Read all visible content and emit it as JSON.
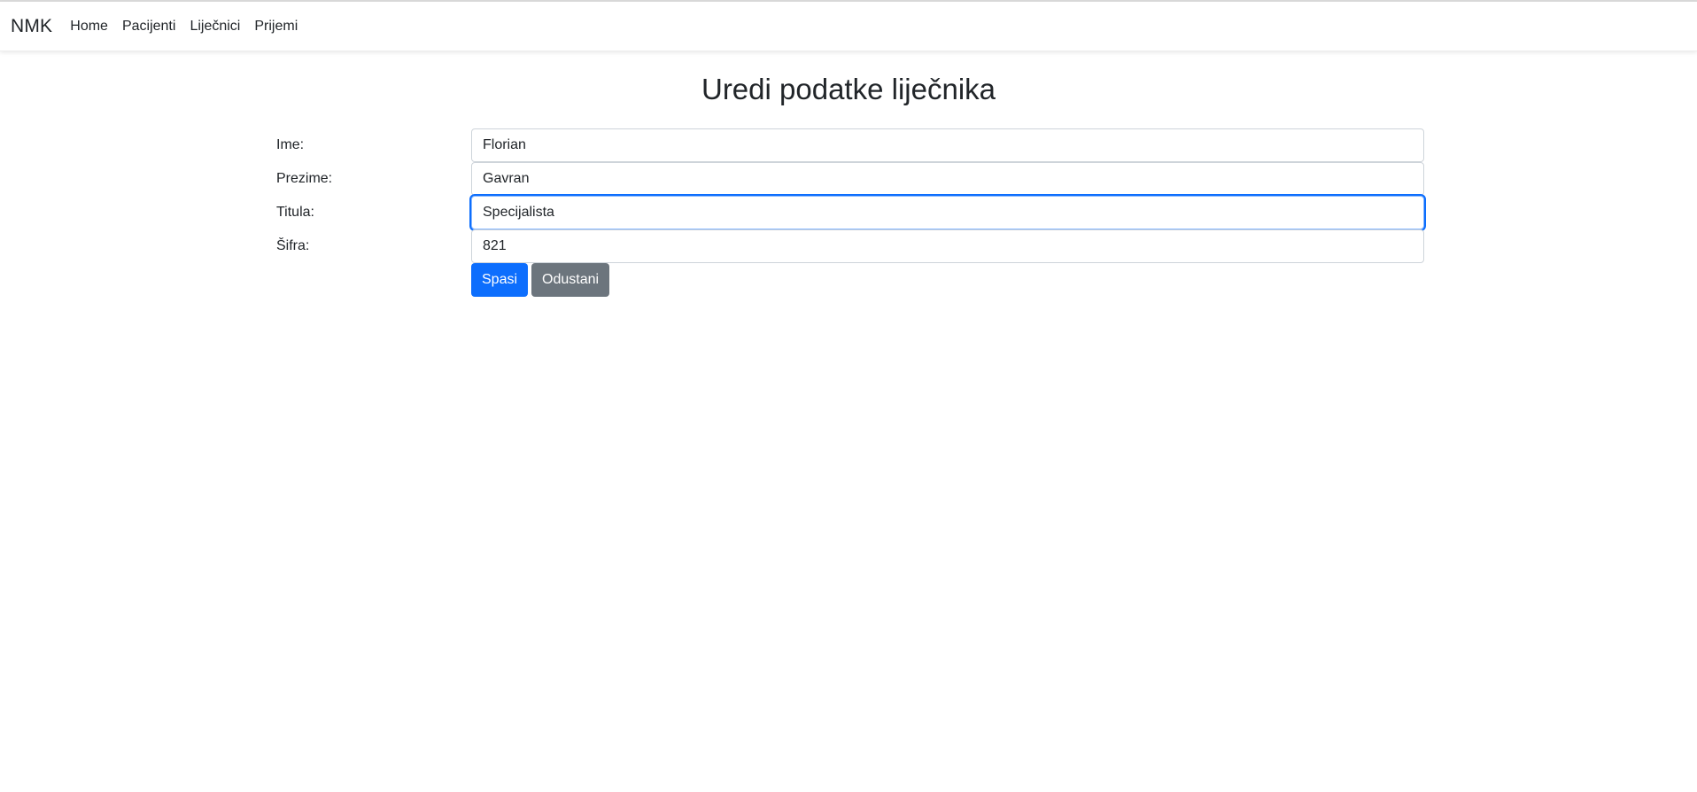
{
  "navbar": {
    "brand": "NMK",
    "links": [
      {
        "label": "Home"
      },
      {
        "label": "Pacijenti"
      },
      {
        "label": "Liječnici"
      },
      {
        "label": "Prijemi"
      }
    ]
  },
  "page": {
    "title": "Uredi podatke liječnika"
  },
  "form": {
    "fields": [
      {
        "label": "Ime:",
        "value": "Florian"
      },
      {
        "label": "Prezime:",
        "value": "Gavran"
      },
      {
        "label": "Titula:",
        "value": "Specijalista",
        "focused": true
      },
      {
        "label": "Šifra:",
        "value": "821"
      }
    ],
    "save_label": "Spasi",
    "cancel_label": "Odustani"
  },
  "colors": {
    "primary": "#0d6efd",
    "secondary": "#6c757d",
    "text": "#212529",
    "input_border": "#ced4da"
  }
}
